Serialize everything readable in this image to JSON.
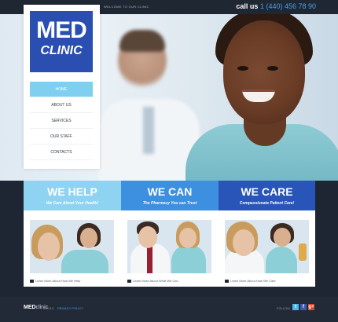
{
  "header": {
    "welcome": "WELCOME TO OUR CLINIC",
    "call_label": "call us",
    "phone": "1 (440) 456 78 90"
  },
  "logo": {
    "line1": "MED",
    "line2": "CLINIC"
  },
  "nav": {
    "items": [
      {
        "label": "HOME",
        "active": true
      },
      {
        "label": "ABOUT US",
        "active": false
      },
      {
        "label": "SERVICES",
        "active": false
      },
      {
        "label": "OUR STAFF",
        "active": false
      },
      {
        "label": "CONTACTS",
        "active": false
      }
    ]
  },
  "features": [
    {
      "title": "WE HELP",
      "subtitle": "We Care About Your Health!",
      "link": "Learn More About How We Help",
      "color": "#8fd3f2"
    },
    {
      "title": "WE CAN",
      "subtitle": "The Pharmacy You can Trust",
      "link": "Learn More About What We Can",
      "color": "#3d8fe0"
    },
    {
      "title": "WE CARE",
      "subtitle": "Compassionate Patient Care!",
      "link": "Learn More About How We Care",
      "color": "#2955b8"
    }
  ],
  "footer": {
    "brand_bold": "MED",
    "brand_light": "clinic",
    "copyright": "© 2013",
    "privacy": "PRIVACY POLICY",
    "follow": "FOLLOW",
    "social": [
      {
        "icon": "twitter-icon",
        "glyph": "t"
      },
      {
        "icon": "facebook-icon",
        "glyph": "f"
      },
      {
        "icon": "google-plus-icon",
        "glyph": "g+"
      }
    ]
  },
  "colors": {
    "accent_light": "#8fd3f2",
    "accent_mid": "#3d8fe0",
    "accent_dark": "#2955b8",
    "logo_blue": "#2a4fb0",
    "dark_bg": "#1f2733"
  }
}
